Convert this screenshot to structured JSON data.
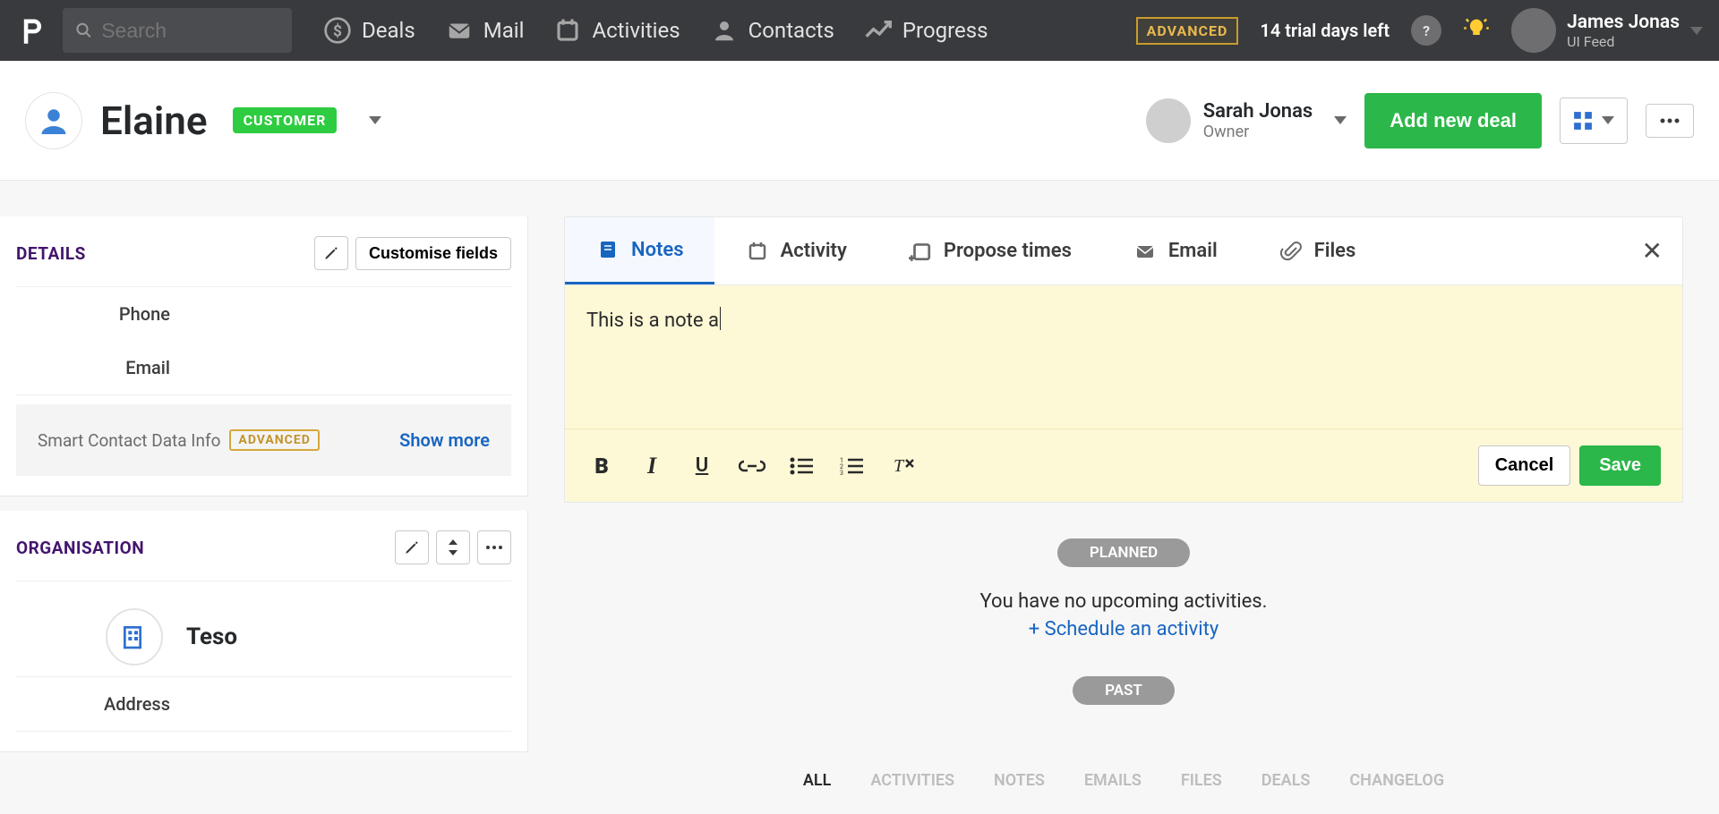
{
  "topbar": {
    "search_placeholder": "Search",
    "nav": [
      {
        "icon": "dollar",
        "label": "Deals"
      },
      {
        "icon": "mail",
        "label": "Mail"
      },
      {
        "icon": "calendar",
        "label": "Activities"
      },
      {
        "icon": "person",
        "label": "Contacts"
      },
      {
        "icon": "progress",
        "label": "Progress"
      }
    ],
    "advanced_badge": "ADVANCED",
    "trial_text": "14 trial days left",
    "user": {
      "name": "James Jonas",
      "role": "UI Feed"
    }
  },
  "subheader": {
    "contact_name": "Elaine",
    "badge": "CUSTOMER",
    "owner": {
      "name": "Sarah Jonas",
      "role": "Owner"
    },
    "new_deal_label": "Add new deal"
  },
  "details": {
    "title": "DETAILS",
    "customise_label": "Customise fields",
    "phone_label": "Phone",
    "email_label": "Email",
    "smart_label": "Smart Contact Data Info",
    "smart_badge": "ADVANCED",
    "show_more": "Show more"
  },
  "organisation": {
    "title": "ORGANISATION",
    "name": "Teso",
    "address_label": "Address"
  },
  "editor": {
    "tabs": [
      "Notes",
      "Activity",
      "Propose times",
      "Email",
      "Files"
    ],
    "note_text": "This is a note a",
    "cancel_label": "Cancel",
    "save_label": "Save"
  },
  "timeline": {
    "planned_label": "PLANNED",
    "empty_msg": "You have no upcoming activities.",
    "schedule_link": "+ Schedule an activity",
    "past_label": "PAST",
    "filters": [
      "ALL",
      "ACTIVITIES",
      "NOTES",
      "EMAILS",
      "FILES",
      "DEALS",
      "CHANGELOG"
    ]
  }
}
